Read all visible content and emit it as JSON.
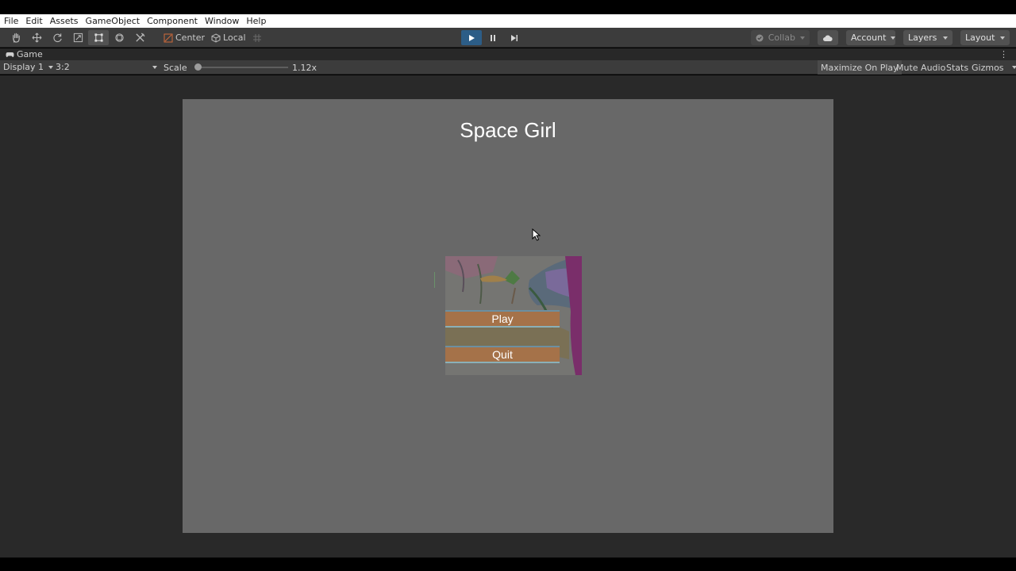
{
  "menu": {
    "items": [
      "File",
      "Edit",
      "Assets",
      "GameObject",
      "Component",
      "Window",
      "Help"
    ]
  },
  "toolbar": {
    "tools": [
      "hand-icon",
      "move-icon",
      "rotate-icon",
      "scale-icon",
      "rect-tool-icon",
      "transform-icon",
      "custom-tool-icon"
    ],
    "active_tool": "rect-tool-icon",
    "pivot_label": "Center",
    "space_label": "Local",
    "collab_label": "Collab",
    "account_label": "Account",
    "layers_label": "Layers",
    "layout_label": "Layout",
    "play_active": true,
    "accent_color": "#2c5d87"
  },
  "game_view": {
    "tab_label": "Game",
    "display_label": "Display 1",
    "aspect_label": "3:2",
    "scale_label": "Scale",
    "scale_value": "1.12x",
    "maximize_label": "Maximize On Play",
    "mute_label": "Mute Audio",
    "stats_label": "Stats",
    "gizmos_label": "Gizmos"
  },
  "game": {
    "title": "Space Girl",
    "play_button": "Play",
    "quit_button": "Quit",
    "background_color": "#686868"
  }
}
